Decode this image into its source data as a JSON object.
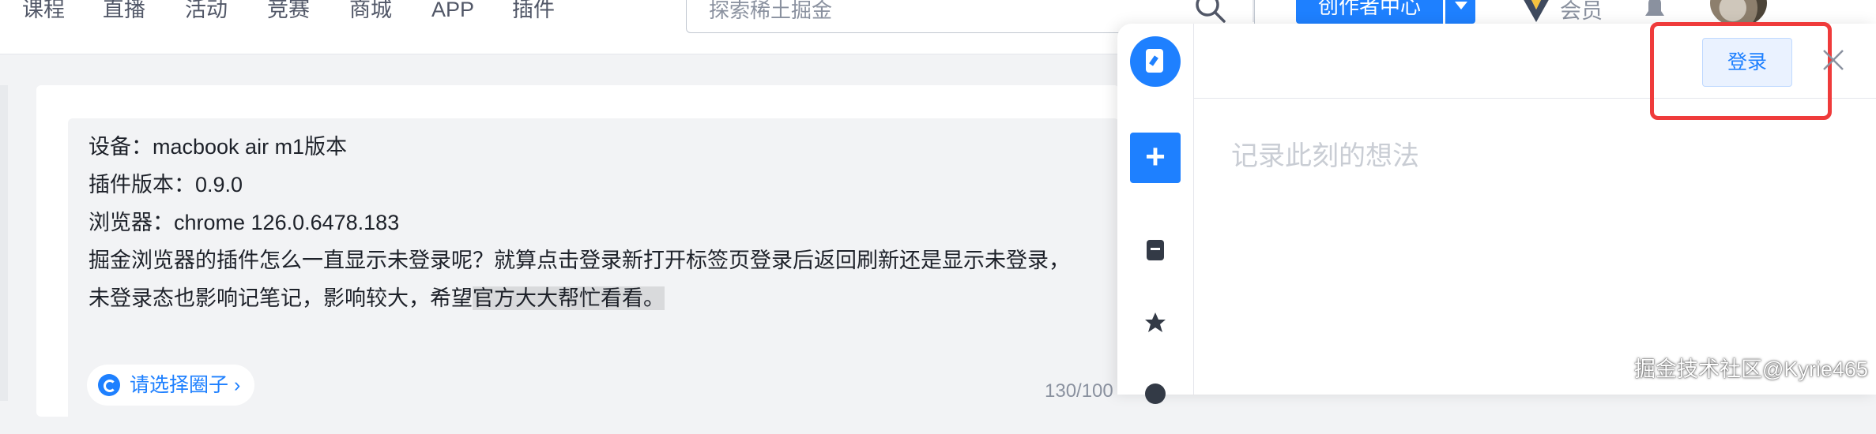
{
  "nav": {
    "items": [
      "课程",
      "直播",
      "活动",
      "竞赛",
      "商城",
      "APP",
      "插件"
    ],
    "search_placeholder": "探索稀土掘金",
    "creator_center": "创作者中心",
    "vip_label": "会员"
  },
  "post": {
    "lines": [
      "设备：macbook air m1版本",
      "插件版本：0.9.0",
      "浏览器：chrome 126.0.6478.183",
      "掘金浏览器的插件怎么一直显示未登录呢？就算点击登录新打开标签页登录后返回刷新还是显示未登录，"
    ],
    "last_line_plain": "未登录态也影响记笔记，影响较大，希望",
    "last_line_highlight": "官方大大帮忙看看。",
    "circle_button": "请选择圈子 ›",
    "char_count": "130/100"
  },
  "panel": {
    "login_button": "登录",
    "note_placeholder": "记录此刻的想法"
  },
  "watermark": "掘金技术社区@Kyrie465",
  "colors": {
    "brand_blue": "#1e80ff",
    "annotation_red": "#ef3b3b"
  },
  "icons": [
    "search-icon",
    "chevron-down-icon",
    "vip-badge-icon",
    "bell-icon",
    "notebook-logo-icon",
    "plus-icon",
    "note-icon",
    "star-icon",
    "clock-icon",
    "close-icon",
    "refresh-icon"
  ]
}
